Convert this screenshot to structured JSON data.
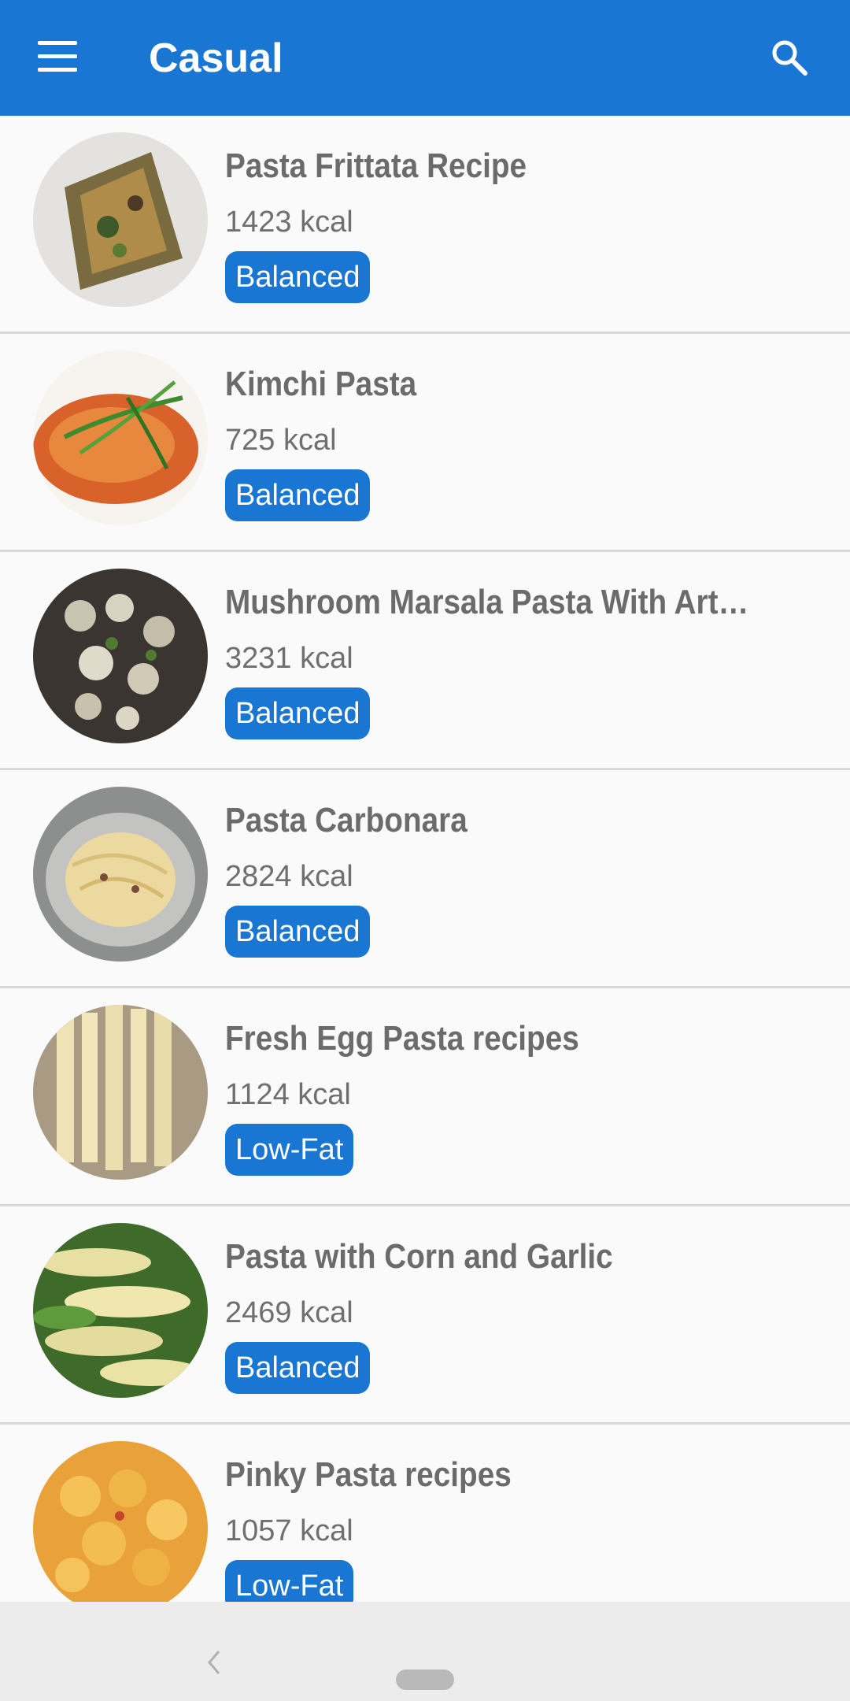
{
  "appbar": {
    "title": "Casual"
  },
  "recipes": [
    {
      "name": "Pasta Frittata Recipe",
      "kcal": "1423 kcal",
      "tag": "Balanced"
    },
    {
      "name": "Kimchi Pasta",
      "kcal": "725 kcal",
      "tag": "Balanced"
    },
    {
      "name": "Mushroom Marsala Pasta With Artich…",
      "kcal": "3231 kcal",
      "tag": "Balanced"
    },
    {
      "name": "Pasta Carbonara",
      "kcal": "2824 kcal",
      "tag": "Balanced"
    },
    {
      "name": "Fresh Egg Pasta recipes",
      "kcal": "1124 kcal",
      "tag": "Low-Fat"
    },
    {
      "name": "Pasta with Corn and Garlic",
      "kcal": "2469 kcal",
      "tag": "Balanced"
    },
    {
      "name": "Pinky Pasta recipes",
      "kcal": "1057 kcal",
      "tag": "Low-Fat"
    }
  ],
  "colors": {
    "primary": "#1976d2",
    "text": "#6b6b6b",
    "divider": "#d8d8d8"
  }
}
